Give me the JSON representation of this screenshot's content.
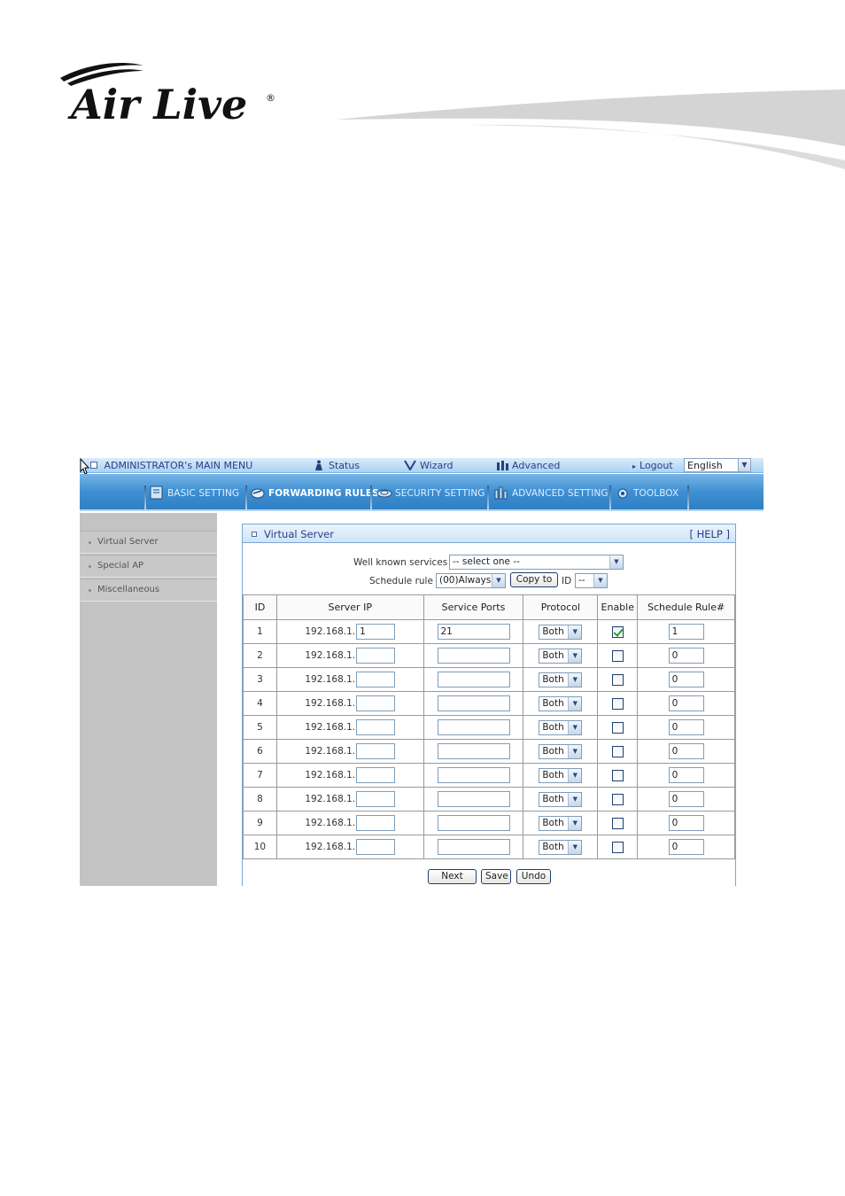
{
  "brand": {
    "logo_text": "Air Live",
    "registered": "®"
  },
  "topbar": {
    "menu_label": "ADMINISTRATOR's MAIN MENU",
    "status": "Status",
    "wizard": "Wizard",
    "advanced": "Advanced",
    "logout": "Logout",
    "language": "English"
  },
  "nav": {
    "tabs": [
      {
        "label": "BASIC SETTING"
      },
      {
        "label": "FORWARDING RULES"
      },
      {
        "label": "SECURITY SETTING"
      },
      {
        "label": "ADVANCED SETTING"
      },
      {
        "label": "TOOLBOX"
      }
    ]
  },
  "sidebar": {
    "items": [
      {
        "label": "Virtual Server"
      },
      {
        "label": "Special AP"
      },
      {
        "label": "Miscellaneous"
      }
    ]
  },
  "panel": {
    "title": "Virtual Server",
    "help": "[ HELP ]",
    "well_known_label": "Well known services",
    "well_known_value": "-- select one --",
    "schedule_label": "Schedule rule",
    "schedule_value": "(00)Always",
    "copy_to": "Copy to",
    "id_label": "ID",
    "id_value": "--"
  },
  "table": {
    "headers": [
      "ID",
      "Server IP",
      "Service Ports",
      "Protocol",
      "Enable",
      "Schedule Rule#"
    ],
    "ip_prefix": "192.168.1.",
    "rows": [
      {
        "id": "1",
        "ip": "1",
        "ports": "21",
        "protocol": "Both",
        "enabled": true,
        "rule": "1"
      },
      {
        "id": "2",
        "ip": "",
        "ports": "",
        "protocol": "Both",
        "enabled": false,
        "rule": "0"
      },
      {
        "id": "3",
        "ip": "",
        "ports": "",
        "protocol": "Both",
        "enabled": false,
        "rule": "0"
      },
      {
        "id": "4",
        "ip": "",
        "ports": "",
        "protocol": "Both",
        "enabled": false,
        "rule": "0"
      },
      {
        "id": "5",
        "ip": "",
        "ports": "",
        "protocol": "Both",
        "enabled": false,
        "rule": "0"
      },
      {
        "id": "6",
        "ip": "",
        "ports": "",
        "protocol": "Both",
        "enabled": false,
        "rule": "0"
      },
      {
        "id": "7",
        "ip": "",
        "ports": "",
        "protocol": "Both",
        "enabled": false,
        "rule": "0"
      },
      {
        "id": "8",
        "ip": "",
        "ports": "",
        "protocol": "Both",
        "enabled": false,
        "rule": "0"
      },
      {
        "id": "9",
        "ip": "",
        "ports": "",
        "protocol": "Both",
        "enabled": false,
        "rule": "0"
      },
      {
        "id": "10",
        "ip": "",
        "ports": "",
        "protocol": "Both",
        "enabled": false,
        "rule": "0"
      }
    ]
  },
  "buttons": {
    "next": "Next >>",
    "save": "Save",
    "undo": "Undo"
  },
  "colors": {
    "nav_blue": "#3e8fd2",
    "link_blue": "#2b3e80",
    "sidebar_gray": "#c3c3c3",
    "check_green": "#21a121"
  }
}
